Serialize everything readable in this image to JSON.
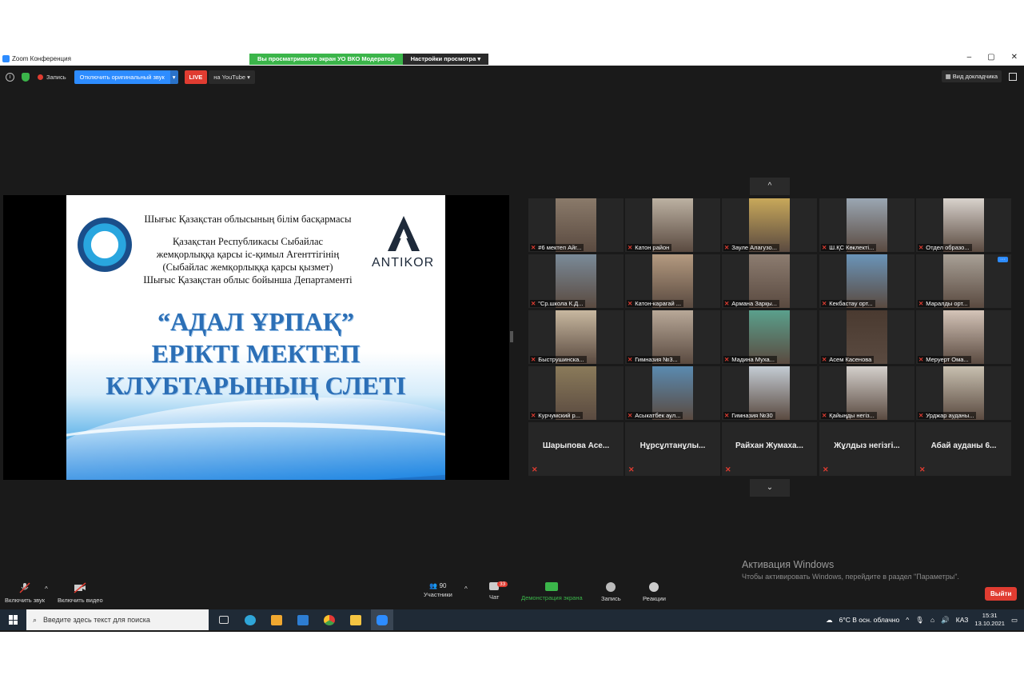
{
  "window": {
    "title": "Zoom Конференция",
    "share_banner": "Вы просматриваете экран УО ВКО Модератор",
    "view_options": "Настройки просмотра",
    "controls": [
      "–",
      "▢",
      "✕"
    ]
  },
  "toolbar": {
    "record_label": "Запись",
    "original_sound": "Отключить оригинальный звук",
    "live_label": "LIVE",
    "youtube_label": "на YouTube",
    "speaker_view": "Вид докладчика"
  },
  "slide": {
    "header_lines": [
      "Шығыс Қазақстан облысының білім басқармасы",
      "Қазақстан Республикасы Сыбайлас",
      "жемқорлыққа қарсы іс-қимыл Агенттігінің",
      "(Сыбайлас жемқорлыққа қарсы қызмет)",
      "Шығыс Қазақстан облыс бойынша Департаменті"
    ],
    "brand": "ANTIKOR",
    "title_lines": [
      "“АДАЛ ҰРПАҚ”",
      "ЕРІКТІ МЕКТЕП",
      "КЛУБТАРЫНЫҢ СЛЕТІ"
    ]
  },
  "gallery": {
    "nav_up": "^",
    "nav_down": "⌄",
    "video_tiles": [
      {
        "name": "#6 мектеп Айг...",
        "color": "#8a7a6a"
      },
      {
        "name": "Катон район",
        "color": "#bcb1a2"
      },
      {
        "name": "Зауле Алагузо...",
        "color": "#c8a85a"
      },
      {
        "name": "Ш.ҚС Көклекті...",
        "color": "#9aa6b2"
      },
      {
        "name": "Отдел образо...",
        "color": "#d8d2cc"
      },
      {
        "name": "\"Ср.школа К.Д...",
        "color": "#7a8a98"
      },
      {
        "name": "Катон-карагай ...",
        "color": "#b49a80"
      },
      {
        "name": "Армана Зарқы...",
        "color": "#8c7c70"
      },
      {
        "name": "Кекбастау орт...",
        "color": "#6a94b8"
      },
      {
        "name": "Маралды орт...",
        "color": "#a8a096"
      },
      {
        "name": "Быструшинска...",
        "color": "#c8b8a0"
      },
      {
        "name": "Гимназия №3...",
        "color": "#b8a898"
      },
      {
        "name": "Мадина Муха...",
        "color": "#5aa08c"
      },
      {
        "name": "Асем Касенова",
        "color": "#4a3a30"
      },
      {
        "name": "Меруерт Ома...",
        "color": "#d4c4b8"
      },
      {
        "name": "Курчумский р...",
        "color": "#8a7a5a"
      },
      {
        "name": "Асыкатбек аул...",
        "color": "#5a8ab0"
      },
      {
        "name": "Гимназия №30",
        "color": "#c4ccd4"
      },
      {
        "name": "Қайыңды негіз...",
        "color": "#d4d0cc"
      },
      {
        "name": "Урджар ауданы...",
        "color": "#c8c0b0"
      }
    ],
    "name_tiles": [
      "Шарыпова Асе...",
      "Нұрсұлтанұлы...",
      "Райхан Жумаха...",
      "Жұлдыз негізгі...",
      "Абай ауданы 6..."
    ]
  },
  "watermark": {
    "title": "Активация Windows",
    "subtitle": "Чтобы активировать Windows, перейдите в раздел \"Параметры\"."
  },
  "controls": {
    "audio": "Включить звук",
    "video": "Включить видео",
    "participants_count": "90",
    "participants": "Участники",
    "chat_badge": "33",
    "chat": "Чат",
    "share": "Демонстрация экрана",
    "record": "Запись",
    "reactions": "Реакции",
    "leave": "Выйти"
  },
  "taskbar": {
    "search_placeholder": "Введите здесь текст для поиска",
    "weather": "6°C  В осн. облачно",
    "lang": "КАЗ",
    "time": "15:31",
    "date": "13.10.2021"
  }
}
